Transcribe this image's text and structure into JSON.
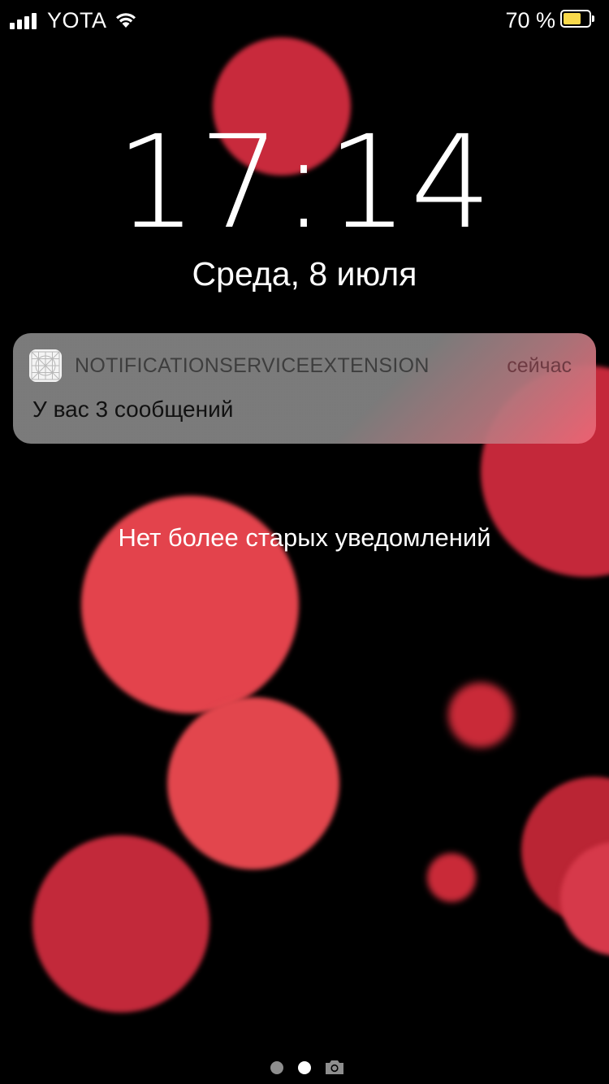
{
  "status_bar": {
    "carrier": "YOTA",
    "battery_percent": "70 %",
    "battery_level": 0.7,
    "battery_color": "#f9d94b",
    "signal_icon": "signal-bars-icon",
    "wifi_icon": "wifi-icon"
  },
  "lock_screen": {
    "time": "17:14",
    "date": "Среда, 8 июля"
  },
  "notification": {
    "app_icon": "app-grid-icon",
    "app_name": "NOTIFICATIONSERVICEEXTENSION",
    "time": "сейчас",
    "body": "У вас 3 сообщений"
  },
  "no_older_notifications": "Нет более старых уведомлений",
  "page_indicator": {
    "pages": 2,
    "current_page": 2,
    "camera_icon": "camera-icon"
  },
  "colors": {
    "background": "#000000",
    "bubble_red": "#e2464d",
    "notification_bg": "#848484"
  }
}
